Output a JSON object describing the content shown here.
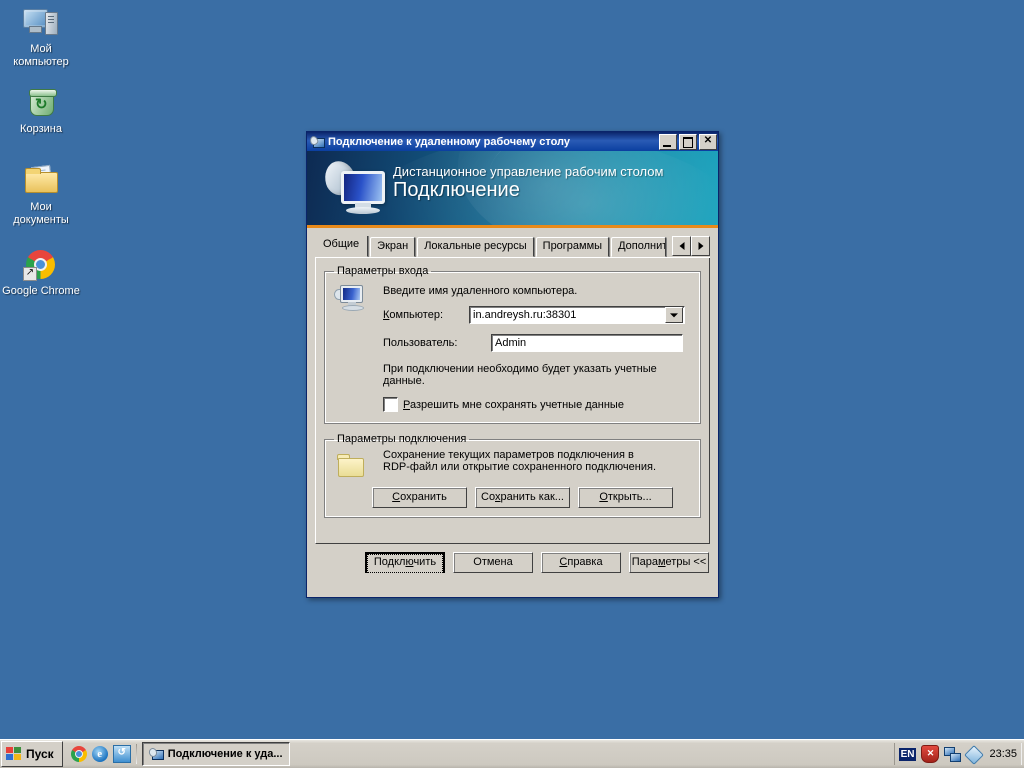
{
  "desktop": {
    "background_color": "#3a6ea5",
    "icons": [
      {
        "name": "my-computer",
        "icon": "my-computer-icon",
        "label_line1": "Мой",
        "label_line2": "компьютер"
      },
      {
        "name": "recycle-bin",
        "icon": "recycle-bin-icon",
        "label_line1": "Корзина",
        "label_line2": ""
      },
      {
        "name": "my-documents",
        "icon": "my-documents-icon",
        "label_line1": "Мои",
        "label_line2": "документы"
      },
      {
        "name": "google-chrome",
        "icon": "chrome-icon",
        "label_line1": "Google Chrome",
        "label_line2": ""
      }
    ]
  },
  "dialog": {
    "title": "Подключение к удаленному рабочему столу",
    "title_icon": "remote-desktop-icon",
    "window_buttons": {
      "minimize": "minimize-icon",
      "maximize": "maximize-icon",
      "close": "close-icon",
      "close_glyph": "✕"
    },
    "banner": {
      "line1": "Дистанционное управление рабочим столом",
      "line2": "Подключение",
      "logo_icon": "monitor-satellite-icon",
      "gradient_from": "#0d2a52",
      "gradient_to": "#1aa3bd",
      "accent_color": "#e88a1a"
    },
    "tabs": [
      {
        "label": "Общие",
        "selected": true
      },
      {
        "label": "Экран",
        "selected": false
      },
      {
        "label": "Локальные ресурсы",
        "selected": false
      },
      {
        "label": "Программы",
        "selected": false
      },
      {
        "label": "Дополнительн",
        "selected": false
      }
    ],
    "tab_scroll": {
      "left_icon": "scroll-left-icon",
      "right_icon": "scroll-right-icon"
    },
    "logon_group": {
      "legend": "Параметры входа",
      "icon": "monitor-icon",
      "hint": "Введите имя удаленного компьютера.",
      "computer_label": "Компьютер:",
      "computer_value": "in.andreysh.ru:38301",
      "user_label": "Пользователь:",
      "user_value": "Admin",
      "note_line1": "При подключении необходимо будет указать учетные",
      "note_line2": "данные.",
      "checkbox_label": "Разрешить мне сохранять учетные данные",
      "checkbox_checked": false
    },
    "connection_group": {
      "legend": "Параметры подключения",
      "icon": "folder-icon",
      "desc_line1": "Сохранение текущих параметров подключения в",
      "desc_line2": "RDP-файл или открытие сохраненного подключения.",
      "save_label": "Сохранить",
      "save_as_label": "Сохранить как...",
      "open_label": "Открыть..."
    },
    "footer": {
      "connect_label": "Подключить",
      "cancel_label": "Отмена",
      "help_label": "Справка",
      "options_label": "Параметры <<"
    }
  },
  "taskbar": {
    "start_label": "Пуск",
    "quick_launch": [
      {
        "name": "chrome",
        "icon": "chrome-icon",
        "glyph": ""
      },
      {
        "name": "internet-explorer",
        "icon": "internet-explorer-icon",
        "glyph": "e"
      },
      {
        "name": "shell-folder",
        "icon": "shell-icon",
        "glyph": "↺"
      }
    ],
    "buttons": [
      {
        "label": "Подключение к уда...",
        "icon": "remote-desktop-icon",
        "active": true
      }
    ],
    "tray": {
      "language": "EN",
      "icons": [
        {
          "name": "security-alert",
          "icon": "shield-alert-icon"
        },
        {
          "name": "network",
          "icon": "network-icon"
        },
        {
          "name": "shell-tray",
          "icon": "shell-tray-icon"
        }
      ],
      "clock": "23:35"
    }
  }
}
